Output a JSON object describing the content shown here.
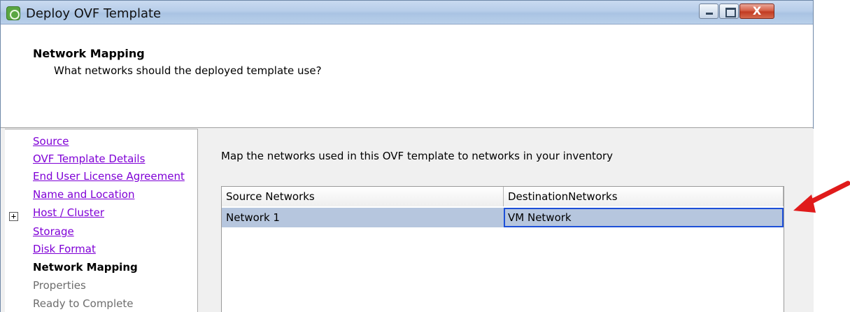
{
  "window": {
    "title": "Deploy OVF Template",
    "controls": {
      "minimize_icon": "minimize-icon",
      "maximize_icon": "maximize-icon",
      "close_label": "X"
    }
  },
  "header": {
    "title": "Network Mapping",
    "subtitle": "What networks should the deployed template use?"
  },
  "nav": {
    "items": [
      {
        "label": "Source",
        "state": "link"
      },
      {
        "label": "OVF Template Details",
        "state": "link"
      },
      {
        "label": "End User License Agreement",
        "state": "link"
      },
      {
        "label": "Name and Location",
        "state": "link"
      },
      {
        "label": "Host / Cluster",
        "state": "link",
        "expander": "+"
      },
      {
        "label": "Storage",
        "state": "link"
      },
      {
        "label": "Disk Format",
        "state": "link"
      },
      {
        "label": "Network Mapping",
        "state": "current"
      },
      {
        "label": "Properties",
        "state": "pending"
      },
      {
        "label": "Ready to Complete",
        "state": "pending"
      }
    ]
  },
  "content": {
    "instruction": "Map the networks used in this OVF template to networks in your inventory",
    "grid": {
      "columns": [
        "Source Networks",
        "DestinationNetworks"
      ],
      "rows": [
        {
          "source": "Network 1",
          "destination": "VM Network"
        }
      ]
    }
  },
  "colors": {
    "link": "#7f00d6",
    "selection_row": "#b6c6de",
    "focus_border": "#1d4fd8",
    "callout_arrow": "#e01b1b"
  }
}
